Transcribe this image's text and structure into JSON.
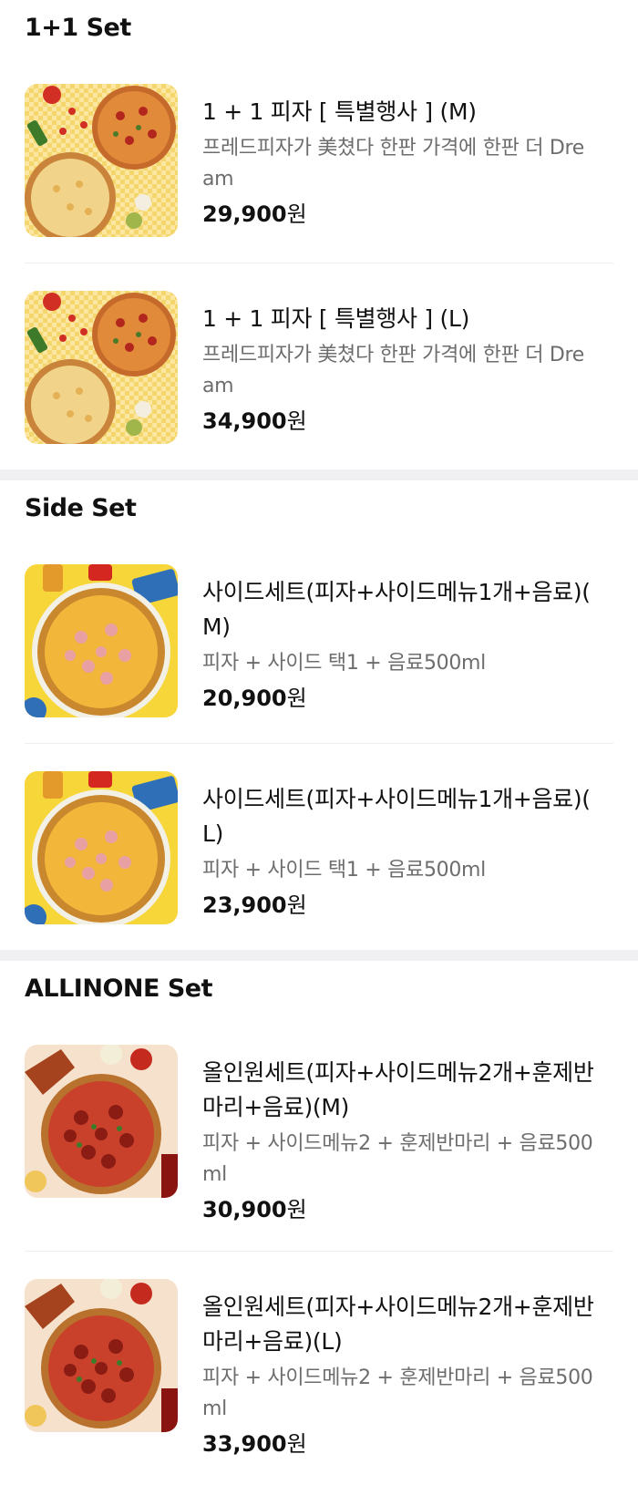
{
  "sections": [
    {
      "title": "1+1 Set",
      "items": [
        {
          "name": "1 + 1 피자 [ 특별행사 ] (M)",
          "desc": "프레드피자가 美쳤다 한판 가격에 한판 더 Dre am",
          "price_num": "29,900",
          "price_unit": "원",
          "image": "pizza-1plus1"
        },
        {
          "name": "1 + 1 피자 [ 특별행사 ] (L)",
          "desc": "프레드피자가 美쳤다 한판 가격에 한판 더 Dre am",
          "price_num": "34,900",
          "price_unit": "원",
          "image": "pizza-1plus1"
        }
      ]
    },
    {
      "title": "Side Set",
      "items": [
        {
          "name": "사이드세트(피자+사이드메뉴1개+음료)( M)",
          "desc": "피자 + 사이드 택1 + 음료500ml",
          "price_num": "20,900",
          "price_unit": "원",
          "image": "pizza-side"
        },
        {
          "name": "사이드세트(피자+사이드메뉴1개+음료)( L)",
          "desc": "피자 + 사이드 택1 + 음료500ml",
          "price_num": "23,900",
          "price_unit": "원",
          "image": "pizza-side"
        }
      ]
    },
    {
      "title": "ALLINONE Set",
      "items": [
        {
          "name": "올인원세트(피자+사이드메뉴2개+훈제반마리+음료)(M)",
          "desc": "피자 + 사이드메뉴2 + 훈제반마리 + 음료500 ml",
          "price_num": "30,900",
          "price_unit": "원",
          "image": "pizza-allinone"
        },
        {
          "name": "올인원세트(피자+사이드메뉴2개+훈제반마리+음료)(L)",
          "desc": "피자 + 사이드메뉴2 + 훈제반마리 + 음료500 ml",
          "price_num": "33,900",
          "price_unit": "원",
          "image": "pizza-allinone"
        }
      ]
    }
  ]
}
